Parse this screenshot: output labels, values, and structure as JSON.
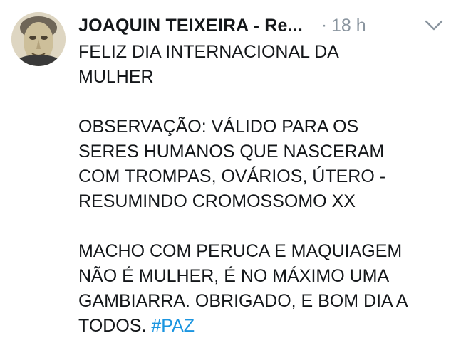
{
  "tweet": {
    "author_name": "JOAQUIN TEIXEIRA - Re...",
    "separator": "·",
    "timestamp": "18 h",
    "menu_icon": "chevron-down-icon",
    "avatar_icon": "avatar-portrait",
    "paragraph1": {
      "line1": "FELIZ DIA INTERNACIONAL DA",
      "line2": "MULHER"
    },
    "paragraph2": {
      "line1": "OBSERVAÇÃO: VÁLIDO PARA OS",
      "line2": "SERES HUMANOS QUE NASCERAM",
      "line3": "COM TROMPAS, OVÁRIOS, ÚTERO -",
      "line4": "RESUMINDO CROMOSSOMO XX"
    },
    "paragraph3": {
      "line1": "MACHO COM PERUCA E MAQUIAGEM",
      "line2": "NÃO É MULHER, É NO MÁXIMO UMA",
      "line3": "GAMBIARRA. OBRIGADO, E BOM DIA A",
      "line4": "TODOS.",
      "hashtag": "#PAZ"
    },
    "colors": {
      "text": "#14171a",
      "secondary": "#8a959f",
      "link": "#1b95e0"
    }
  }
}
